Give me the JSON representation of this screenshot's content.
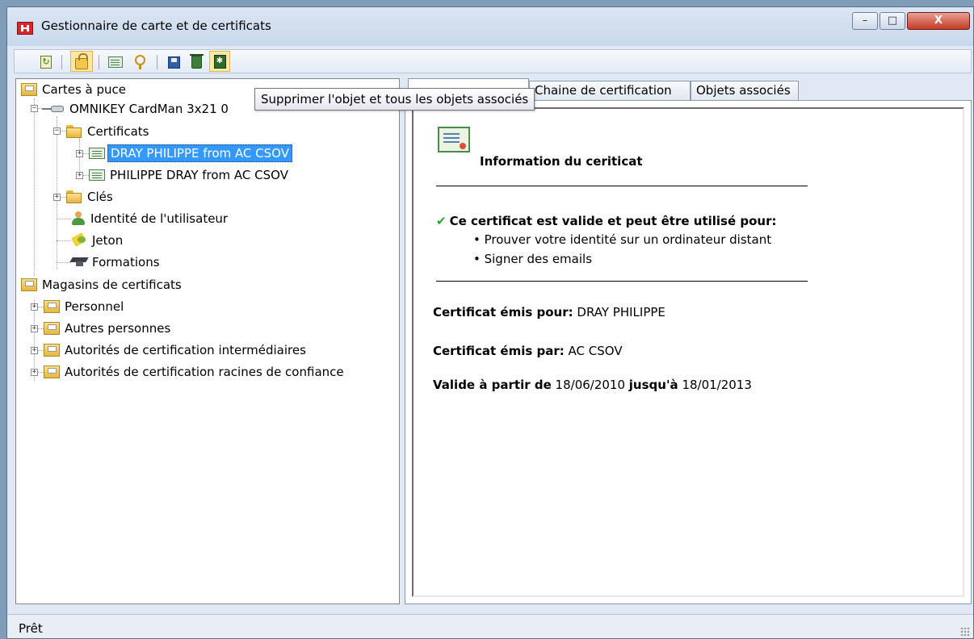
{
  "window": {
    "title": "Gestionnaire de carte et de certificats",
    "buttons": {
      "minimize": "–",
      "maximize": "□",
      "close": "X"
    }
  },
  "toolbar": {
    "icons": [
      "refresh-icon",
      "lock-icon",
      "certificate-icon",
      "keys-icon",
      "save-icon",
      "delete-icon",
      "delete-all-icon"
    ],
    "tooltip": "Supprimer l'objet et tous les objets associés"
  },
  "tree": {
    "smart_cards": "Cartes à puce",
    "reader": "OMNIKEY CardMan 3x21 0",
    "certificates": "Certificats",
    "cert1": "DRAY PHILIPPE from AC CSOV",
    "cert2": "PHILIPPE DRAY from AC CSOV",
    "keys": "Clés",
    "user_identity": "Identité de l'utilisateur",
    "token": "Jeton",
    "trainings": "Formations",
    "cert_stores": "Magasins de certificats",
    "personal": "Personnel",
    "other_people": "Autres personnes",
    "intermediate_ca": "Autorités de certification intermédiaires",
    "root_ca": "Autorités de certification racines de confiance"
  },
  "tabs": {
    "general": "",
    "chain": "Chaine de certification",
    "related": "Objets associés"
  },
  "details": {
    "heading": "Information du ceriticat",
    "valid_statement": "Ce certificat est valide et peut être utilisé pour:",
    "purpose1": "• Prouver votre identité sur un ordinateur distant",
    "purpose2": "• Signer des emails",
    "issued_to_label": "Certificat émis pour:",
    "issued_to_value": " DRAY PHILIPPE",
    "issued_by_label": "Certificat émis par:",
    "issued_by_value": " AC CSOV",
    "valid_from_label": "Valide à partir de",
    "valid_from_value": " 18/06/2010 ",
    "valid_to_label": "jusqu'à",
    "valid_to_value": " 18/01/2013"
  },
  "status": {
    "text": "Prêt"
  }
}
